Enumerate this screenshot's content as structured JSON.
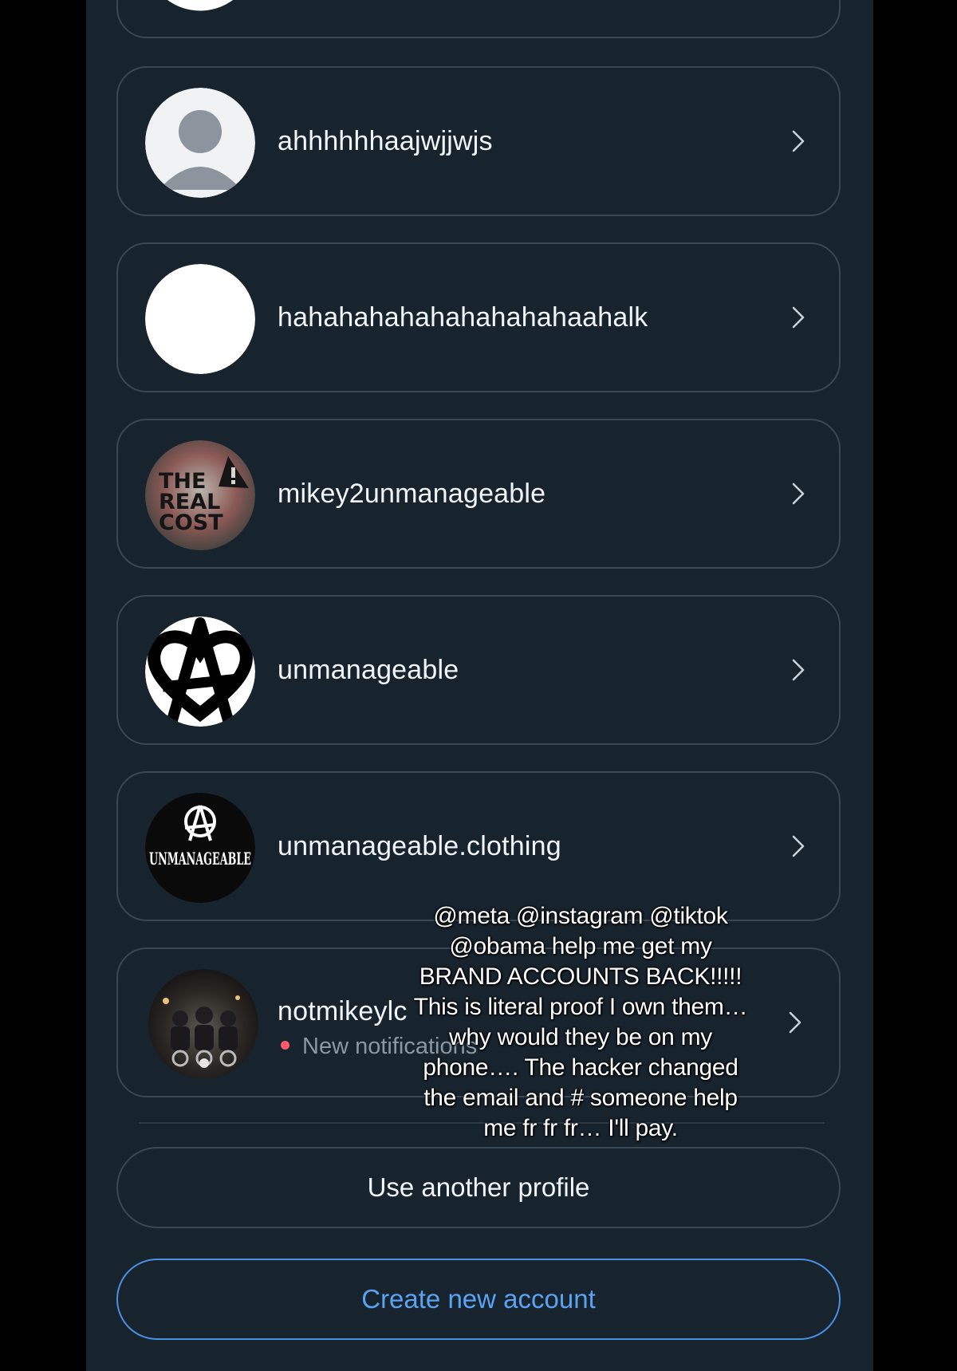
{
  "accounts": [
    {
      "username": "ahhhhhhaajwjjwjs",
      "avatar": "default-person-icon"
    },
    {
      "username": "hahahahahahahahahahaahalk",
      "avatar": "blank-white-avatar"
    },
    {
      "username": "mikey2unmanageable",
      "avatar": "the-real-cost-logo",
      "avatar_text": "THE REAL COST"
    },
    {
      "username": "unmanageable",
      "avatar": "anarchy-heart-logo"
    },
    {
      "username": "unmanageable.clothing",
      "avatar": "unmanageable-clothing-logo",
      "avatar_text": "UNMANAGEABLE"
    },
    {
      "username": "notmikeylc",
      "avatar": "group-photo-avatar",
      "notification": "New notifications"
    }
  ],
  "buttons": {
    "use_another_profile": "Use another profile",
    "create_new_account": "Create new account"
  },
  "caption": "@meta @instagram @tiktok @obama help me get my BRAND ACCOUNTS BACK!!!!! This is literal proof I own them… why would they be on my phone…. The hacker changed the email and # someone help me fr fr fr… I'll pay.",
  "colors": {
    "background": "#17232d",
    "card_border": "#394853",
    "text": "#f2f5f7",
    "link_blue": "#5aa2f2",
    "notification_dot": "#ff5a6e"
  }
}
